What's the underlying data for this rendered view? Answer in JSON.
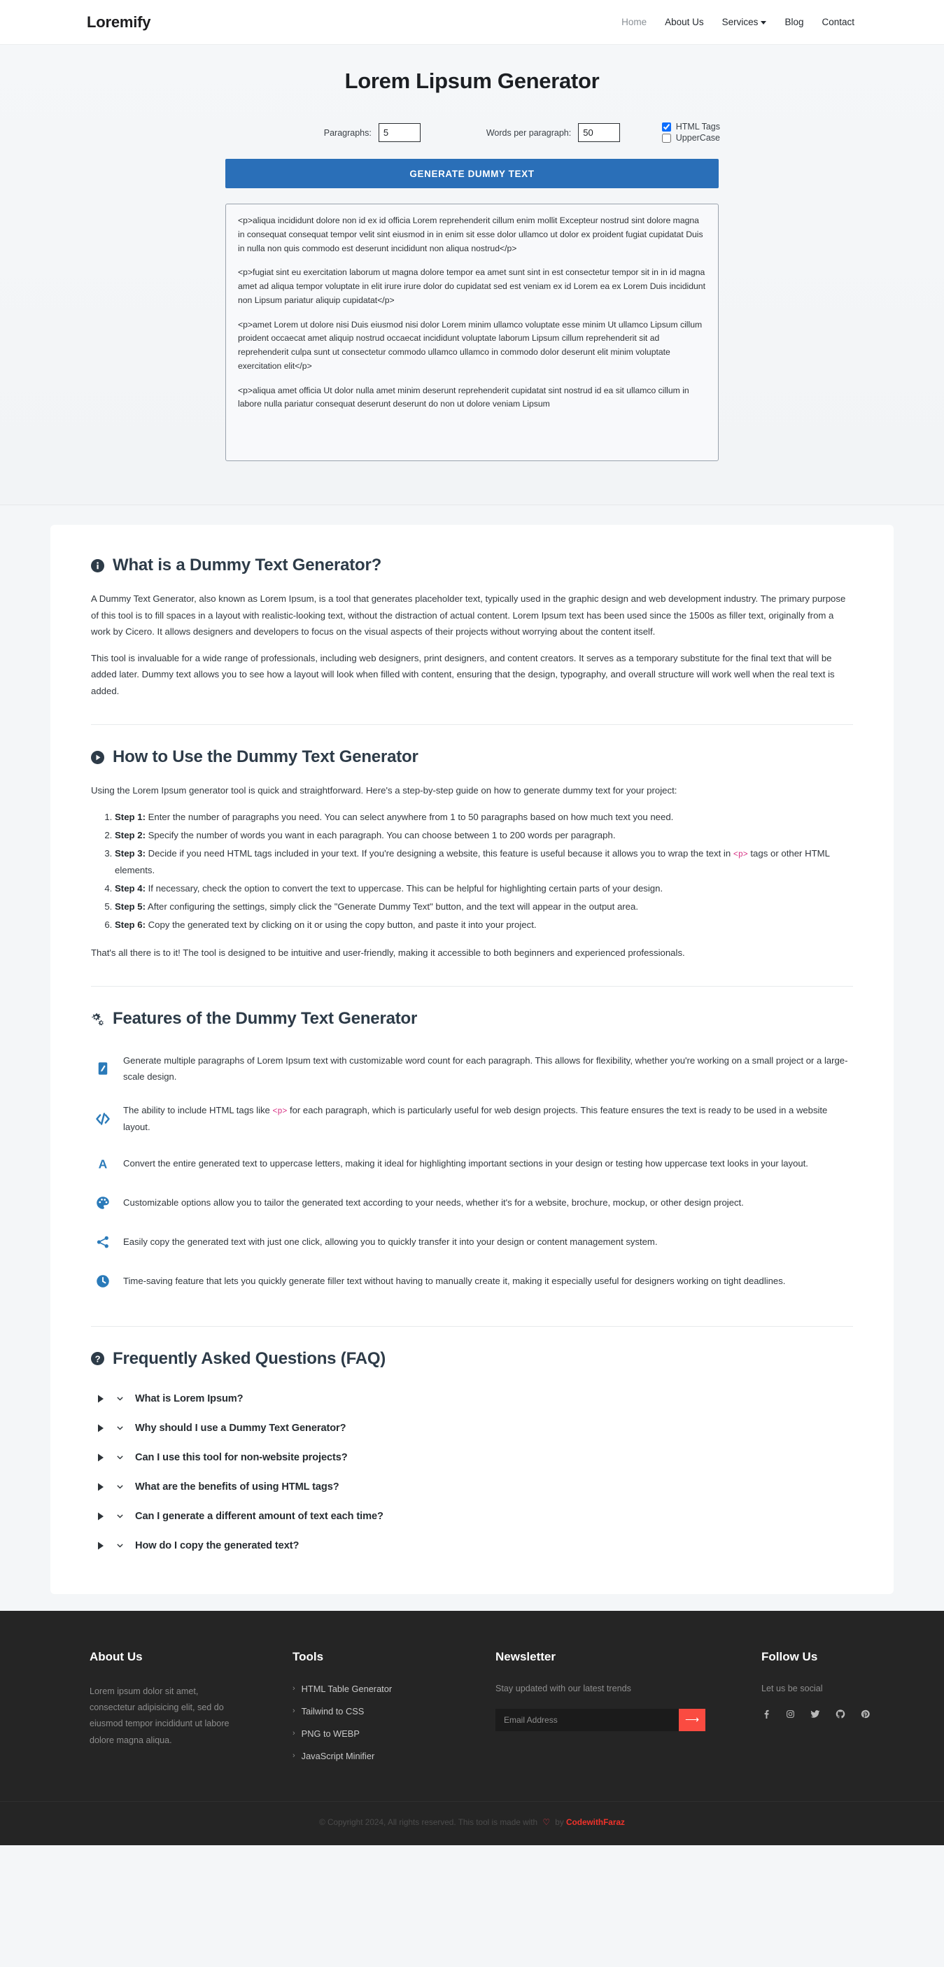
{
  "navbar": {
    "brand": "Loremify",
    "links": [
      {
        "label": "Home",
        "icon": "home-link"
      },
      {
        "label": "About Us",
        "icon": "about-link"
      },
      {
        "label": "Services",
        "icon": "services-link",
        "has_caret": true
      },
      {
        "label": "Blog",
        "icon": "blog-link"
      },
      {
        "label": "Contact",
        "icon": "contact-link"
      }
    ]
  },
  "hero": {
    "title": "Lorem Lipsum Generator",
    "paragraphs_label": "Paragraphs:",
    "paragraphs_value": "5",
    "words_label": "Words per paragraph:",
    "words_value": "50",
    "html_tags_label": "HTML Tags",
    "html_tags_checked": true,
    "uppercase_label": "UpperCase",
    "uppercase_checked": false,
    "generate_button": "GENERATE DUMMY TEXT",
    "accent_color": "#2a6fb8",
    "output": [
      "<p>aliqua incididunt dolore non id ex id officia Lorem reprehenderit cillum enim mollit Excepteur nostrud sint dolore magna in consequat consequat tempor velit sint eiusmod in in enim sit esse dolor ullamco ut dolor ex proident fugiat cupidatat Duis in nulla non quis commodo est deserunt incididunt non aliqua nostrud</p>",
      "<p>fugiat sint eu exercitation laborum ut magna dolore tempor ea amet sunt sint in est consectetur tempor sit in in id magna amet ad aliqua tempor voluptate in elit irure irure dolor do cupidatat sed est veniam ex id Lorem ea ex Lorem Duis incididunt non Lipsum pariatur aliquip cupidatat</p>",
      "<p>amet Lorem ut dolore nisi Duis eiusmod nisi dolor Lorem minim ullamco voluptate esse minim Ut ullamco Lipsum cillum proident occaecat amet aliquip nostrud occaecat incididunt voluptate laborum Lipsum cillum reprehenderit sit ad reprehenderit culpa sunt ut consectetur commodo ullamco ullamco in commodo dolor deserunt elit minim voluptate exercitation elit</p>",
      "<p>aliqua amet officia Ut dolor nulla amet minim deserunt reprehenderit cupidatat sint nostrud id ea sit ullamco cillum in labore nulla pariatur consequat deserunt deserunt do non ut dolore veniam Lipsum"
    ]
  },
  "sections": {
    "what_is": {
      "icon": "info-circle-icon",
      "title": "What is a Dummy Text Generator?",
      "paragraphs": [
        "A Dummy Text Generator, also known as Lorem Ipsum, is a tool that generates placeholder text, typically used in the graphic design and web development industry. The primary purpose of this tool is to fill spaces in a layout with realistic-looking text, without the distraction of actual content. Lorem Ipsum text has been used since the 1500s as filler text, originally from a work by Cicero. It allows designers and developers to focus on the visual aspects of their projects without worrying about the content itself.",
        "This tool is invaluable for a wide range of professionals, including web designers, print designers, and content creators. It serves as a temporary substitute for the final text that will be added later. Dummy text allows you to see how a layout will look when filled with content, ensuring that the design, typography, and overall structure will work well when the real text is added."
      ]
    },
    "how_to": {
      "icon": "play-circle-icon",
      "title": "How to Use the Dummy Text Generator",
      "intro": "Using the Lorem Ipsum generator tool is quick and straightforward. Here's a step-by-step guide on how to generate dummy text for your project:",
      "steps": [
        {
          "label": "Step 1:",
          "text": " Enter the number of paragraphs you need. You can select anywhere from 1 to 50 paragraphs based on how much text you need."
        },
        {
          "label": "Step 2:",
          "text": " Specify the number of words you want in each paragraph. You can choose between 1 to 200 words per paragraph."
        },
        {
          "label": "Step 3:",
          "text": " Decide if you need HTML tags included in your text. If you're designing a website, this feature is useful because it allows you to wrap the text in ",
          "code": "<p>",
          "text_after": " tags or other HTML elements."
        },
        {
          "label": "Step 4:",
          "text": " If necessary, check the option to convert the text to uppercase. This can be helpful for highlighting certain parts of your design."
        },
        {
          "label": "Step 5:",
          "text": " After configuring the settings, simply click the \"Generate Dummy Text\" button, and the text will appear in the output area."
        },
        {
          "label": "Step 6:",
          "text": " Copy the generated text by clicking on it or using the copy button, and paste it into your project."
        }
      ],
      "outro": "That's all there is to it! The tool is designed to be intuitive and user-friendly, making it accessible to both beginners and experienced professionals."
    },
    "features": {
      "icon": "gears-icon",
      "title": "Features of the Dummy Text Generator",
      "items": [
        {
          "icon": "pencil-square-icon",
          "text": "Generate multiple paragraphs of Lorem Ipsum text with customizable word count for each paragraph. This allows for flexibility, whether you're working on a small project or a large-scale design."
        },
        {
          "icon": "code-slash-icon",
          "text_before": "The ability to include HTML tags like ",
          "code": "<p>",
          "text_after": " for each paragraph, which is particularly useful for web design projects. This feature ensures the text is ready to be used in a website layout."
        },
        {
          "icon": "font-uppercase-icon",
          "text": "Convert the entire generated text to uppercase letters, making it ideal for highlighting important sections in your design or testing how uppercase text looks in your layout."
        },
        {
          "icon": "palette-icon",
          "text": "Customizable options allow you to tailor the generated text according to your needs, whether it's for a website, brochure, mockup, or other design project."
        },
        {
          "icon": "share-icon",
          "text": "Easily copy the generated text with just one click, allowing you to quickly transfer it into your design or content management system."
        },
        {
          "icon": "clock-icon",
          "text": "Time-saving feature that lets you quickly generate filler text without having to manually create it, making it especially useful for designers working on tight deadlines."
        }
      ]
    },
    "faq": {
      "icon": "question-circle-icon",
      "title": "Frequently Asked Questions (FAQ)",
      "items": [
        {
          "question": "What is Lorem Ipsum?"
        },
        {
          "question": "Why should I use a Dummy Text Generator?"
        },
        {
          "question": "Can I use this tool for non-website projects?"
        },
        {
          "question": "What are the benefits of using HTML tags?"
        },
        {
          "question": "Can I generate a different amount of text each time?"
        },
        {
          "question": "How do I copy the generated text?"
        }
      ]
    }
  },
  "footer": {
    "about": {
      "title": "About Us",
      "description": "Lorem ipsum dolor sit amet, consectetur adipisicing elit, sed do eiusmod tempor incididunt ut labore dolore magna aliqua."
    },
    "tools": {
      "title": "Tools",
      "links": [
        "HTML Table Generator",
        "Tailwind to CSS",
        "PNG to WEBP",
        "JavaScript Minifier"
      ]
    },
    "newsletter": {
      "title": "Newsletter",
      "subtitle": "Stay updated with our latest trends",
      "placeholder": "Email Address",
      "button_icon": "arrow-right-icon",
      "button_color": "#fa4b41"
    },
    "follow": {
      "title": "Follow Us",
      "subtitle": "Let us be social",
      "socials": [
        "facebook-icon",
        "instagram-icon",
        "twitter-icon",
        "github-icon",
        "pinterest-icon"
      ]
    },
    "copyright": {
      "text_before": "© Copyright 2024, All rights reserved. This tool is made with",
      "heart": "♡",
      "text_mid": "by",
      "author": "CodewithFaraz"
    }
  }
}
